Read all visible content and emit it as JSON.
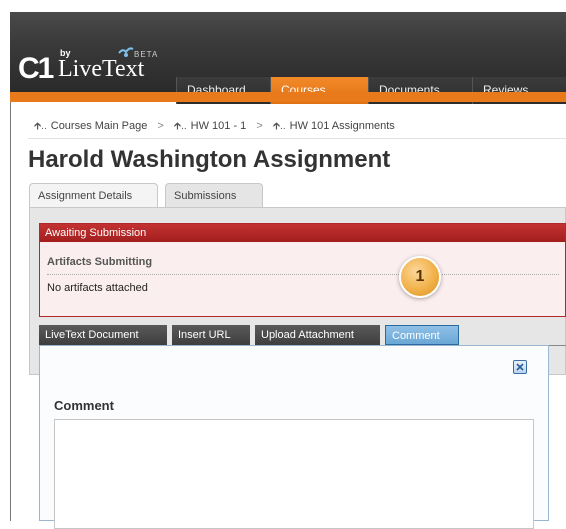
{
  "header": {
    "logo_c1": "C1",
    "logo_by": "by",
    "logo_brand": "LiveText",
    "logo_beta": "BETA",
    "nav_tabs": [
      {
        "label": "Dashboard"
      },
      {
        "label": "Courses"
      },
      {
        "label": "Documents"
      },
      {
        "label": "Reviews"
      }
    ],
    "accent_color": "#e87a1c"
  },
  "breadcrumb": {
    "items": [
      {
        "label": "Courses Main Page"
      },
      {
        "label": "HW 101 - 1"
      },
      {
        "label": "HW 101 Assignments"
      }
    ],
    "separator": ">"
  },
  "page_title": "Harold Washington Assignment",
  "sub_tabs": [
    {
      "label": "Assignment Details"
    },
    {
      "label": "Submissions"
    }
  ],
  "awaiting": {
    "header": "Awaiting Submission",
    "artifacts_title": "Artifacts Submitting",
    "artifacts_value": "No artifacts attached"
  },
  "callout_badge": "1",
  "action_tabs": [
    {
      "label": "LiveText Document"
    },
    {
      "label": "Insert URL"
    },
    {
      "label": "Upload Attachment"
    },
    {
      "label": "Comment"
    }
  ],
  "comment_dialog": {
    "label": "Comment",
    "value": ""
  }
}
